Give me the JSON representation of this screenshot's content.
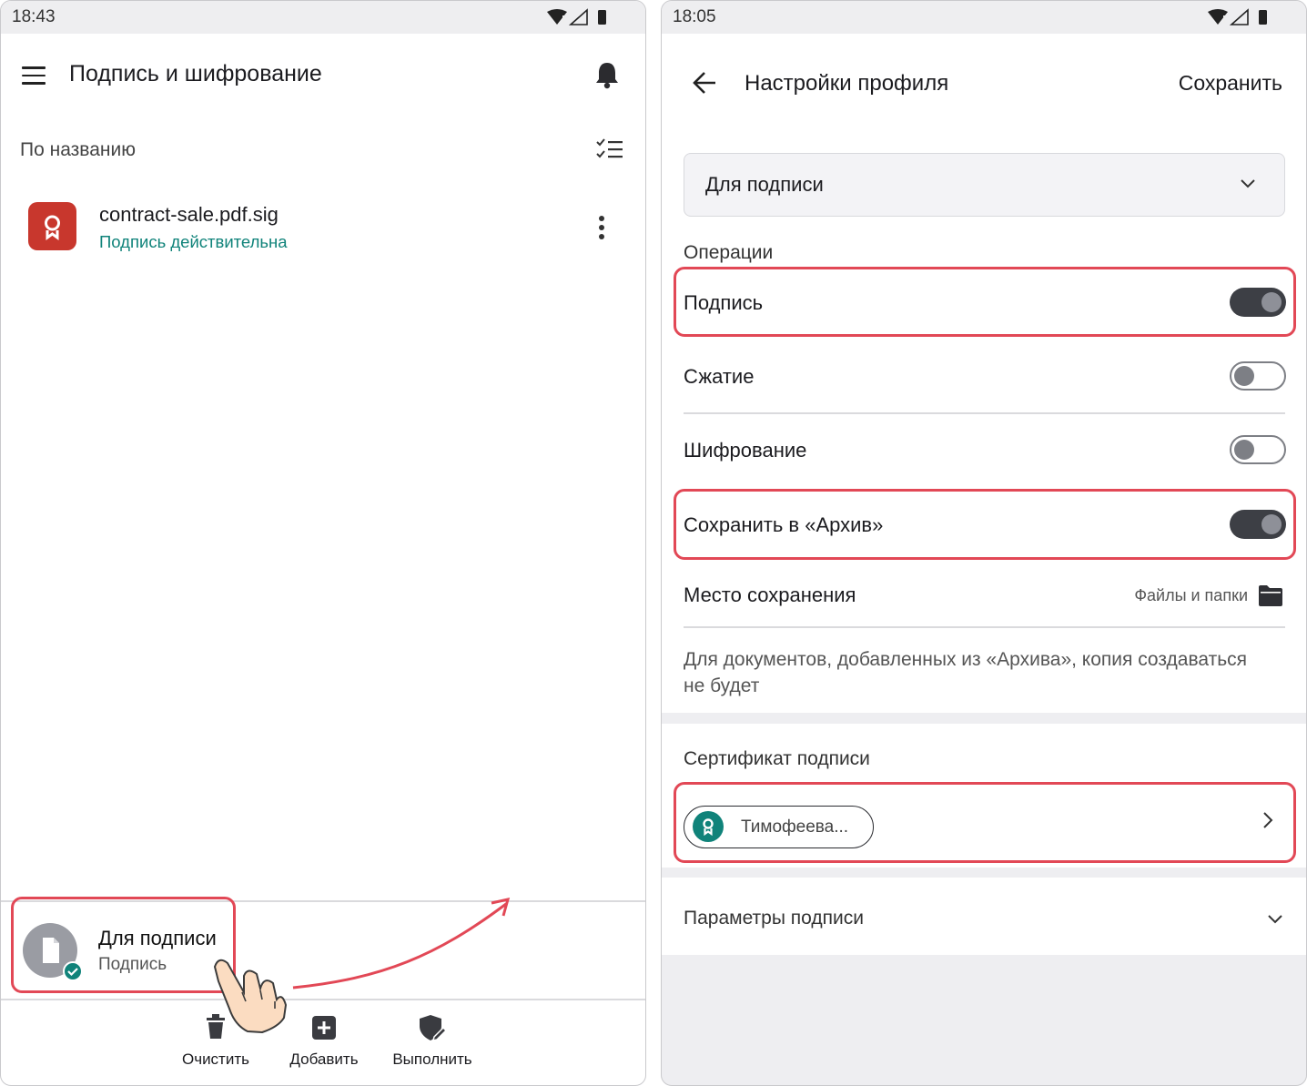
{
  "left": {
    "status_time": "18:43",
    "header_title": "Подпись и шифрование",
    "sort_label": "По названию",
    "file": {
      "name": "contract-sale.pdf.sig",
      "status": "Подпись действительна",
      "status_color": "#10837a",
      "icon_color": "#c8372d"
    },
    "profile": {
      "title": "Для подписи",
      "subtitle": "Подпись"
    },
    "actions": [
      {
        "label": "Очистить",
        "icon": "trash-icon"
      },
      {
        "label": "Добавить",
        "icon": "plus-box-icon"
      },
      {
        "label": "Выполнить",
        "icon": "shield-pen-icon"
      }
    ]
  },
  "right": {
    "status_time": "18:05",
    "header_title": "Настройки профиля",
    "save_label": "Сохранить",
    "profile_select": "Для подписи",
    "operations_heading": "Операции",
    "operations": [
      {
        "label": "Подпись",
        "on": true
      },
      {
        "label": "Сжатие",
        "on": false
      },
      {
        "label": "Шифрование",
        "on": false
      },
      {
        "label": "Сохранить в «Архив»",
        "on": true
      }
    ],
    "save_place_label": "Место сохранения",
    "save_place_value": "Файлы и папки",
    "note": "Для документов, добавленных из «Архива», копия создаваться не будет",
    "cert_heading": "Сертификат подписи",
    "cert_name": "Тимофеева...",
    "params_label": "Параметры подписи"
  },
  "colors": {
    "highlight": "#e24856",
    "teal": "#10837a",
    "toggle_on": "#3d3f45"
  }
}
